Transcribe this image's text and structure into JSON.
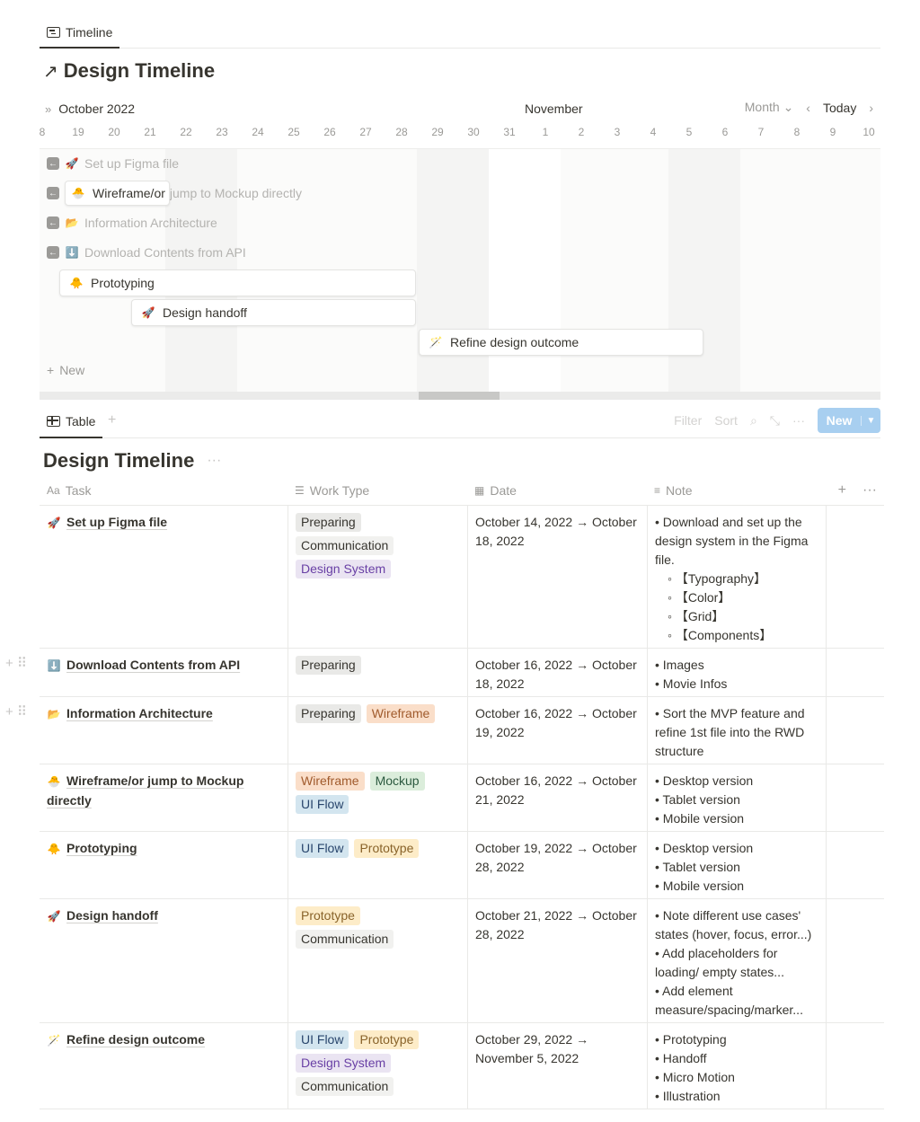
{
  "top_tab": {
    "label": "Timeline"
  },
  "page_title": "Design Timeline",
  "timeline": {
    "month_left": "October 2022",
    "month_right": "November",
    "view_mode": "Month",
    "today_label": "Today",
    "days": [
      "8",
      "19",
      "20",
      "21",
      "22",
      "23",
      "24",
      "25",
      "26",
      "27",
      "28",
      "29",
      "30",
      "31",
      "1",
      "2",
      "3",
      "4",
      "5",
      "6",
      "7",
      "8",
      "9",
      "10"
    ],
    "items": [
      {
        "emoji": "🚀",
        "label": "Set up Figma file"
      },
      {
        "emoji": "🐣",
        "label_a": "Wireframe/or",
        "label_b": " jump to Mockup directly"
      },
      {
        "emoji": "📂",
        "label": "Information Architecture"
      },
      {
        "emoji": "⬇️",
        "label": "Download Contents from API"
      },
      {
        "emoji": "🐥",
        "label": "Prototyping"
      },
      {
        "emoji": "🚀",
        "label": "Design handoff"
      },
      {
        "emoji": "🪄",
        "label": "Refine design outcome"
      }
    ],
    "new_label": "New"
  },
  "table_view": {
    "tab_label": "Table",
    "tools": {
      "filter": "Filter",
      "sort": "Sort"
    },
    "new_button": "New"
  },
  "database_title": "Design Timeline",
  "columns": {
    "task": {
      "icon": "Aa",
      "label": "Task"
    },
    "work_type": {
      "label": "Work Type"
    },
    "date": {
      "label": "Date"
    },
    "note": {
      "label": "Note"
    }
  },
  "rows": [
    {
      "emoji": "🚀",
      "task": "Set up Figma file",
      "tags": [
        {
          "text": "Preparing",
          "bg": "#e9e9e7",
          "fg": "#37352f"
        },
        {
          "text": "Communication",
          "bg": "#f1f1ef",
          "fg": "#37352f"
        },
        {
          "text": "Design System",
          "bg": "#eae4f2",
          "fg": "#6940a5"
        }
      ],
      "date_1": "October 14, 2022 → October",
      "date_2": "18, 2022",
      "notes": [
        {
          "t": "• Download and set up the",
          "sub": false
        },
        {
          "t": "design system in the Figma",
          "sub": false
        },
        {
          "t": "file.",
          "sub": false
        },
        {
          "t": "◦ 【Typography】",
          "sub": true
        },
        {
          "t": "◦ 【Color】",
          "sub": true
        },
        {
          "t": "◦ 【Grid】",
          "sub": true
        },
        {
          "t": "◦ 【Components】",
          "sub": true
        }
      ]
    },
    {
      "emoji": "⬇️",
      "task": "Download Contents from API",
      "tags": [
        {
          "text": "Preparing",
          "bg": "#e9e9e7",
          "fg": "#37352f"
        }
      ],
      "date_1": "October 16, 2022 → October",
      "date_2": "18, 2022",
      "notes": [
        {
          "t": "• Images",
          "sub": false
        },
        {
          "t": "• Movie Infos",
          "sub": false
        }
      ]
    },
    {
      "emoji": "📂",
      "task": "Information Architecture",
      "tags": [
        {
          "text": "Preparing",
          "bg": "#e9e9e7",
          "fg": "#37352f"
        },
        {
          "text": "Wireframe",
          "bg": "#fadec9",
          "fg": "#a05a2c"
        }
      ],
      "date_1": "October 16, 2022 → October",
      "date_2": "19, 2022",
      "notes": [
        {
          "t": "• Sort the MVP feature and",
          "sub": false
        },
        {
          "t": "refine 1st file into the RWD",
          "sub": false
        },
        {
          "t": "structure",
          "sub": false
        }
      ]
    },
    {
      "emoji": "🐣",
      "task": "Wireframe/or jump to Mockup",
      "task_2": "directly",
      "tags": [
        {
          "text": "Wireframe",
          "bg": "#fadec9",
          "fg": "#a05a2c"
        },
        {
          "text": "Mockup",
          "bg": "#dbeddb",
          "fg": "#2b593f"
        },
        {
          "text": "UI Flow",
          "bg": "#d3e5ef",
          "fg": "#28456c"
        }
      ],
      "date_1": "October 16, 2022 → October",
      "date_2": "21, 2022",
      "notes": [
        {
          "t": "• Desktop version",
          "sub": false
        },
        {
          "t": "• Tablet version",
          "sub": false
        },
        {
          "t": "• Mobile version",
          "sub": false
        }
      ]
    },
    {
      "emoji": "🐥",
      "task": "Prototyping",
      "tags": [
        {
          "text": "UI Flow",
          "bg": "#d3e5ef",
          "fg": "#28456c"
        },
        {
          "text": "Prototype",
          "bg": "#fdecc8",
          "fg": "#89632a"
        }
      ],
      "date_1": "October 19, 2022 → October",
      "date_2": "28, 2022",
      "notes": [
        {
          "t": "• Desktop version",
          "sub": false
        },
        {
          "t": "• Tablet version",
          "sub": false
        },
        {
          "t": "• Mobile version",
          "sub": false
        }
      ]
    },
    {
      "emoji": "🚀",
      "task": "Design handoff",
      "tags": [
        {
          "text": "Prototype",
          "bg": "#fdecc8",
          "fg": "#89632a"
        },
        {
          "text": "Communication",
          "bg": "#f1f1ef",
          "fg": "#37352f"
        }
      ],
      "date_1": "October 21, 2022 → October",
      "date_2": "28, 2022",
      "notes": [
        {
          "t": "• Note different use cases'",
          "sub": false
        },
        {
          "t": "states (hover, focus, error...)",
          "sub": false
        },
        {
          "t": "• Add placeholders for",
          "sub": false
        },
        {
          "t": "loading/ empty states...",
          "sub": false
        },
        {
          "t": "• Add element",
          "sub": false
        },
        {
          "t": "measure/spacing/marker...",
          "sub": false
        }
      ]
    },
    {
      "emoji": "🪄",
      "task": "Refine design outcome",
      "tags": [
        {
          "text": "UI Flow",
          "bg": "#d3e5ef",
          "fg": "#28456c"
        },
        {
          "text": "Prototype",
          "bg": "#fdecc8",
          "fg": "#89632a"
        },
        {
          "text": "Design System",
          "bg": "#eae4f2",
          "fg": "#6940a5"
        },
        {
          "text": "Communication",
          "bg": "#f1f1ef",
          "fg": "#37352f"
        }
      ],
      "date_1": "October 29, 2022 →",
      "date_2": "November 5, 2022",
      "notes": [
        {
          "t": "• Prototyping",
          "sub": false
        },
        {
          "t": "• Handoff",
          "sub": false
        },
        {
          "t": "• Micro Motion",
          "sub": false
        },
        {
          "t": "• Illustration",
          "sub": false
        }
      ]
    }
  ]
}
